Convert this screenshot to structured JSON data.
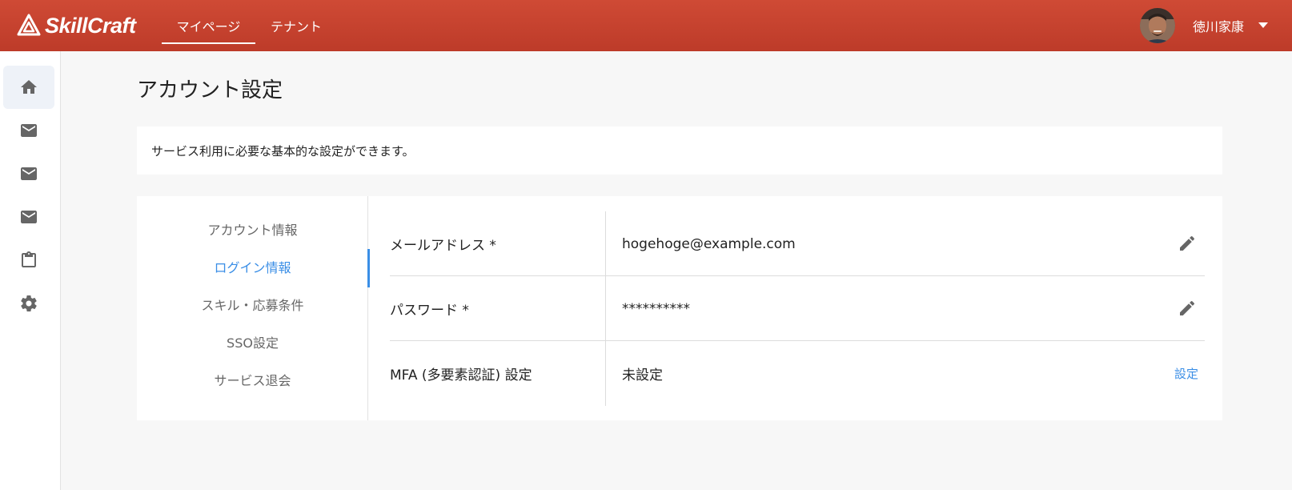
{
  "header": {
    "brand": "SkillCraft",
    "tabs": [
      {
        "label": "マイページ",
        "active": true
      },
      {
        "label": "テナント",
        "active": false
      }
    ],
    "user": {
      "name": "徳川家康"
    }
  },
  "rail": {
    "items": [
      {
        "icon": "home-icon",
        "active": true
      },
      {
        "icon": "mail-icon",
        "active": false
      },
      {
        "icon": "mail-icon",
        "active": false
      },
      {
        "icon": "mail-icon",
        "active": false
      },
      {
        "icon": "clipboard-icon",
        "active": false
      },
      {
        "icon": "gear-icon",
        "active": false
      }
    ]
  },
  "page": {
    "title": "アカウント設定",
    "description": "サービス利用に必要な基本的な設定ができます。"
  },
  "side_menu": {
    "items": [
      {
        "label": "アカウント情報",
        "active": false
      },
      {
        "label": "ログイン情報",
        "active": true
      },
      {
        "label": "スキル・応募条件",
        "active": false
      },
      {
        "label": "SSO設定",
        "active": false
      },
      {
        "label": "サービス退会",
        "active": false
      }
    ]
  },
  "login_info": {
    "email": {
      "label": "メールアドレス *",
      "value": "hogehoge@example.com"
    },
    "password": {
      "label": "パスワード *",
      "value": "**********"
    },
    "mfa": {
      "label": "MFA (多要素認証) 設定",
      "value": "未設定",
      "action": "設定"
    }
  },
  "colors": {
    "header": "#c8432f",
    "accent": "#3a8ee6",
    "rail_active_bg": "#eef2f8"
  }
}
